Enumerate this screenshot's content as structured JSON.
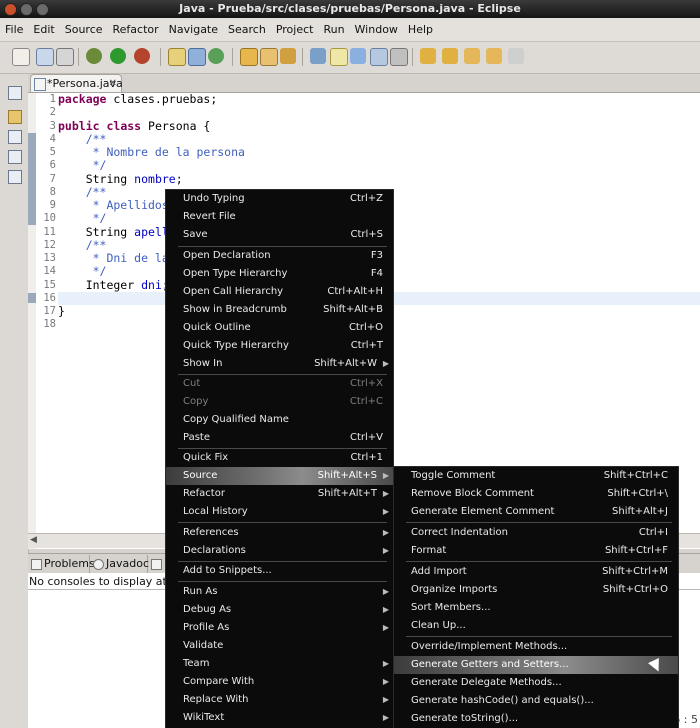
{
  "window": {
    "title": "Java - Prueba/src/clases/pruebas/Persona.java - Eclipse"
  },
  "menubar": [
    "File",
    "Edit",
    "Source",
    "Refactor",
    "Navigate",
    "Search",
    "Project",
    "Run",
    "Window",
    "Help"
  ],
  "editor": {
    "tab_label": "*Persona.java",
    "line_numbers": [
      "1",
      "2",
      "3",
      "4",
      "5",
      "6",
      "7",
      "8",
      "9",
      "10",
      "11",
      "12",
      "13",
      "14",
      "15",
      "16",
      "17",
      "18"
    ],
    "code": {
      "l1_kw": "package",
      "l1_rest": " clases.pruebas;",
      "l3_kw1": "public",
      "l3_kw2": "class",
      "l3_rest": " Persona {",
      "l4": "    /**",
      "l5": "     * Nombre de la persona",
      "l6": "     */",
      "l7_type": "    String ",
      "l7_field": "nombre",
      "l7_end": ";",
      "l8": "    /**",
      "l9": "     * Apellidos d",
      "l10": "     */",
      "l11_type": "    String ",
      "l11_field": "apellid",
      "l12": "    /**",
      "l13": "     * Dni de la p",
      "l14": "     */",
      "l15_type": "    Integer ",
      "l15_field": "dni",
      "l15_end": ";",
      "l17": "}"
    }
  },
  "bottom_panel": {
    "tabs": [
      "Problems",
      "Javadoc",
      ""
    ],
    "message": "No consoles to display at this t"
  },
  "status": {
    "position": "6 : 5"
  },
  "context_menu": {
    "items": [
      {
        "label": "Undo Typing",
        "accel": "Ctrl+Z"
      },
      {
        "label": "Revert File",
        "accel": ""
      },
      {
        "label": "Save",
        "accel": "Ctrl+S"
      },
      {
        "label": "Open Declaration",
        "accel": "F3"
      },
      {
        "label": "Open Type Hierarchy",
        "accel": "F4"
      },
      {
        "label": "Open Call Hierarchy",
        "accel": "Ctrl+Alt+H"
      },
      {
        "label": "Show in Breadcrumb",
        "accel": "Shift+Alt+B"
      },
      {
        "label": "Quick Outline",
        "accel": "Ctrl+O"
      },
      {
        "label": "Quick Type Hierarchy",
        "accel": "Ctrl+T"
      },
      {
        "label": "Show In",
        "accel": "Shift+Alt+W"
      },
      {
        "label": "Cut",
        "accel": "Ctrl+X"
      },
      {
        "label": "Copy",
        "accel": "Ctrl+C"
      },
      {
        "label": "Copy Qualified Name",
        "accel": ""
      },
      {
        "label": "Paste",
        "accel": "Ctrl+V"
      },
      {
        "label": "Quick Fix",
        "accel": "Ctrl+1"
      },
      {
        "label": "Source",
        "accel": "Shift+Alt+S"
      },
      {
        "label": "Refactor",
        "accel": "Shift+Alt+T"
      },
      {
        "label": "Local History",
        "accel": ""
      },
      {
        "label": "References",
        "accel": ""
      },
      {
        "label": "Declarations",
        "accel": ""
      },
      {
        "label": "Add to Snippets...",
        "accel": ""
      },
      {
        "label": "Run As",
        "accel": ""
      },
      {
        "label": "Debug As",
        "accel": ""
      },
      {
        "label": "Profile As",
        "accel": ""
      },
      {
        "label": "Validate",
        "accel": ""
      },
      {
        "label": "Team",
        "accel": ""
      },
      {
        "label": "Compare With",
        "accel": ""
      },
      {
        "label": "Replace With",
        "accel": ""
      },
      {
        "label": "WikiText",
        "accel": ""
      }
    ]
  },
  "source_submenu": {
    "items": [
      {
        "label": "Toggle Comment",
        "accel": "Shift+Ctrl+C"
      },
      {
        "label": "Remove Block Comment",
        "accel": "Shift+Ctrl+\\"
      },
      {
        "label": "Generate Element Comment",
        "accel": "Shift+Alt+J"
      },
      {
        "label": "Correct Indentation",
        "accel": "Ctrl+I"
      },
      {
        "label": "Format",
        "accel": "Shift+Ctrl+F"
      },
      {
        "label": "Add Import",
        "accel": "Shift+Ctrl+M"
      },
      {
        "label": "Organize Imports",
        "accel": "Shift+Ctrl+O"
      },
      {
        "label": "Sort Members...",
        "accel": ""
      },
      {
        "label": "Clean Up...",
        "accel": ""
      },
      {
        "label": "Override/Implement Methods...",
        "accel": ""
      },
      {
        "label": "Generate Getters and Setters...",
        "accel": ""
      },
      {
        "label": "Generate Delegate Methods...",
        "accel": ""
      },
      {
        "label": "Generate hashCode() and equals()...",
        "accel": ""
      },
      {
        "label": "Generate toString()...",
        "accel": ""
      }
    ]
  }
}
